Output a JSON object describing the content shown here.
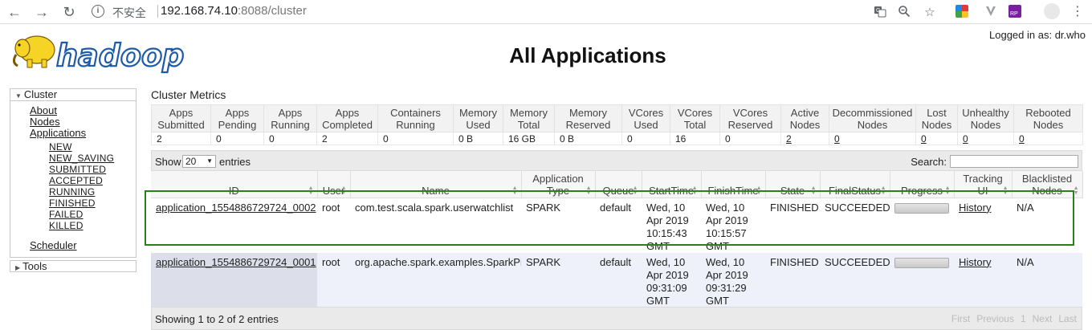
{
  "browser": {
    "security_label": "不安全",
    "url_host": "192.168.74.10",
    "url_rest": ":8088/cluster"
  },
  "header": {
    "logged_in": "Logged in as: dr.who",
    "title": "All Applications",
    "logo_text": "hadoop"
  },
  "sidebar": {
    "cluster_label": "Cluster",
    "links": [
      "About",
      "Nodes",
      "Applications"
    ],
    "states": [
      "NEW",
      "NEW_SAVING",
      "SUBMITTED",
      "ACCEPTED",
      "RUNNING",
      "FINISHED",
      "FAILED",
      "KILLED"
    ],
    "scheduler": "Scheduler",
    "tools_label": "Tools"
  },
  "metrics": {
    "title": "Cluster Metrics",
    "headers": [
      "Apps Submitted",
      "Apps Pending",
      "Apps Running",
      "Apps Completed",
      "Containers Running",
      "Memory Used",
      "Memory Total",
      "Memory Reserved",
      "VCores Used",
      "VCores Total",
      "VCores Reserved",
      "Active Nodes",
      "Decommissioned Nodes",
      "Lost Nodes",
      "Unhealthy Nodes",
      "Rebooted Nodes"
    ],
    "values": [
      "2",
      "0",
      "0",
      "2",
      "0",
      "0 B",
      "16 GB",
      "0 B",
      "0",
      "16",
      "0",
      "2",
      "0",
      "0",
      "0",
      "0"
    ]
  },
  "apps_table": {
    "show_label": "Show",
    "page_size": "20",
    "entries_label": "entries",
    "search_label": "Search:",
    "search_value": "",
    "headers": [
      "ID",
      "User",
      "Name",
      "Application Type",
      "Queue",
      "StartTime",
      "FinishTime",
      "State",
      "FinalStatus",
      "Progress",
      "Tracking UI",
      "Blacklisted Nodes"
    ],
    "rows": [
      {
        "id": "application_1554886729724_0002",
        "user": "root",
        "name": "com.test.scala.spark.userwatchlist",
        "type": "SPARK",
        "queue": "default",
        "start": "Wed, 10 Apr 2019 10:15:43 GMT",
        "finish": "Wed, 10 Apr 2019 10:15:57 GMT",
        "state": "FINISHED",
        "final_status": "SUCCEEDED",
        "progress": 1.0,
        "tracking": "History",
        "blacklisted": "N/A"
      },
      {
        "id": "application_1554886729724_0001",
        "user": "root",
        "name": "org.apache.spark.examples.SparkPi",
        "type": "SPARK",
        "queue": "default",
        "start": "Wed, 10 Apr 2019 09:31:09 GMT",
        "finish": "Wed, 10 Apr 2019 09:31:29 GMT",
        "state": "FINISHED",
        "final_status": "SUCCEEDED",
        "progress": 1.0,
        "tracking": "History",
        "blacklisted": "N/A"
      }
    ],
    "showing": "Showing 1 to 2 of 2 entries",
    "pager": [
      "First",
      "Previous",
      "1",
      "Next",
      "Last"
    ]
  },
  "colors": {
    "highlight": "#2e7d1f",
    "logo_yellow": "#f5d426",
    "logo_blue": "#1e5aa8"
  }
}
